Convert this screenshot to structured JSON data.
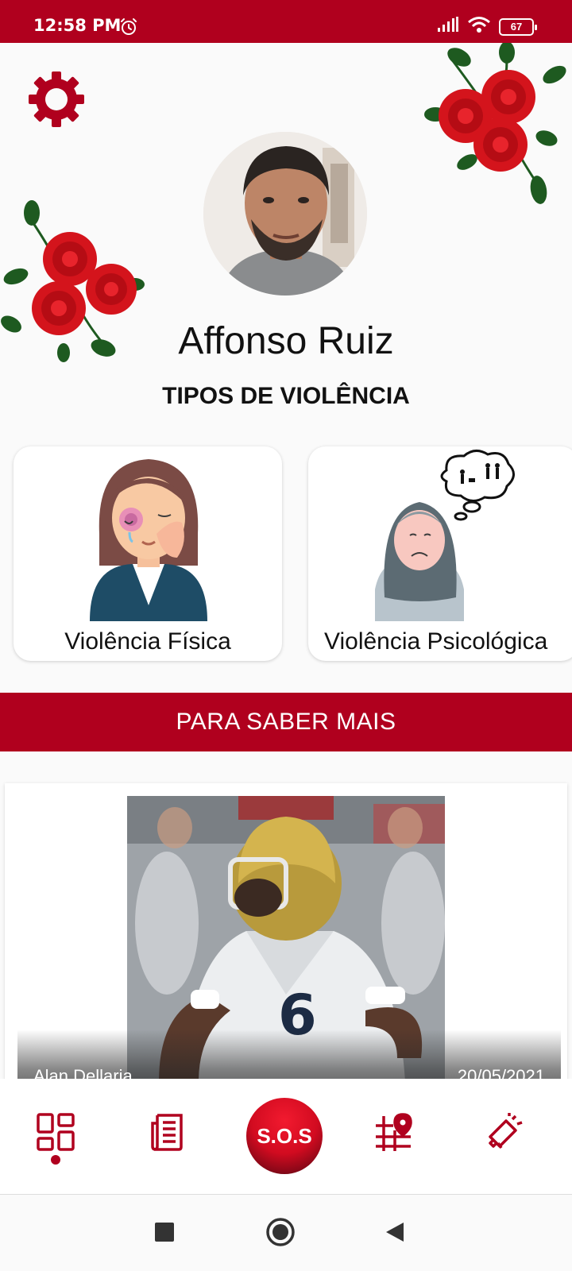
{
  "status_bar": {
    "time": "12:58 PM",
    "battery": "67",
    "icons": [
      "alarm-icon",
      "signal-icon",
      "wifi-icon",
      "battery-icon"
    ]
  },
  "profile": {
    "name": "Affonso Ruiz"
  },
  "section": {
    "title": "TIPOS DE VIOLÊNCIA"
  },
  "cards": [
    {
      "label": "Violência Física"
    },
    {
      "label": "Violência Psicológica"
    }
  ],
  "info_banner": {
    "label": "PARA SABER MAIS"
  },
  "news": {
    "author": "Alan Dellaria",
    "date": "20/05/2021"
  },
  "bottom_nav": {
    "sos_label": "S.O.S",
    "items": [
      "dashboard-icon",
      "news-icon",
      "sos-button",
      "map-pin-icon",
      "megaphone-icon"
    ]
  },
  "colors": {
    "accent": "#b0001e",
    "background": "#fafafa"
  }
}
